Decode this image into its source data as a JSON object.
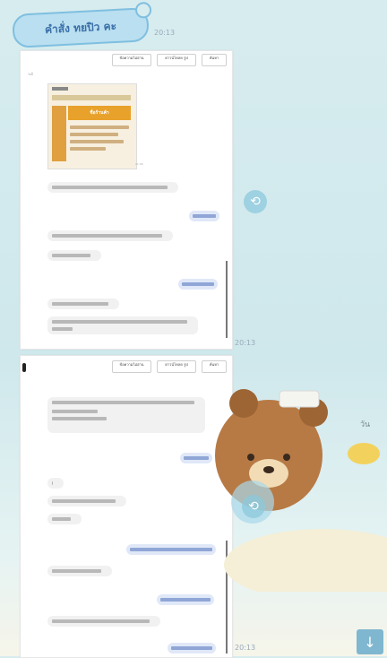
{
  "sticker": {
    "text": "คำสั่ง ทยปิว คะ",
    "time": "20:13"
  },
  "shot1": {
    "buttons": [
      "ข้อความไม่อ่าน",
      "ดาวน์โหลด รูป",
      "ค้นหา"
    ],
    "top_label": "วันนี้",
    "card_title": "ชื่อร้านค้า",
    "time_label": "21:00",
    "outgoing": [
      "รับทราบ",
      "ชำระแล้ว"
    ],
    "outer_time": "20:13"
  },
  "shot2": {
    "buttons": [
      "ข้อความไม่อ่าน",
      "ดาวน์โหลด รูป",
      "ค้นหา"
    ],
    "outgoing": [
      "รับทราบ",
      "ชำระเงินแล้วค่ะ",
      "รับทราบค่ะ",
      "ยืนยันค่ะ"
    ],
    "outer_time": "20:13"
  },
  "side": {
    "label": "วัน"
  },
  "icons": {
    "share": "share-icon",
    "down": "arrow-down-icon"
  },
  "colors": {
    "outgoing": "#e0e8f8",
    "incoming": "#f1f1f1",
    "accent": "#7fb7d0"
  }
}
